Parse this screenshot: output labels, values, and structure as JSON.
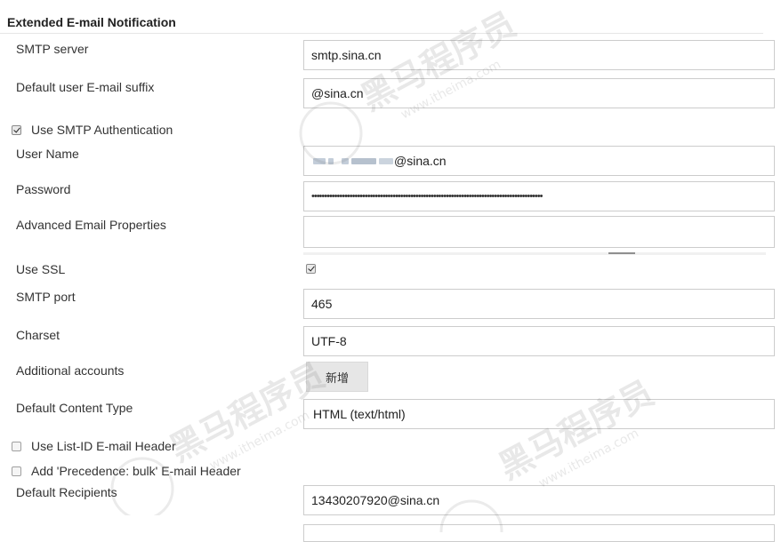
{
  "section": {
    "title": "Extended E-mail Notification"
  },
  "fields": {
    "smtp_server": {
      "label": "SMTP server",
      "value": "smtp.sina.cn"
    },
    "email_suffix": {
      "label": "Default user E-mail suffix",
      "value": "@sina.cn"
    },
    "use_smtp_auth": {
      "label": "Use SMTP Authentication",
      "checked": true
    },
    "user_name": {
      "label": "User Name",
      "value_suffix": "@sina.cn"
    },
    "password": {
      "label": "Password",
      "value": "•••••••••••••••••••••••••••••••••••••••••••••••••••••••••••••••••••••••••••••••••••••••••••"
    },
    "advanced_props": {
      "label": "Advanced Email Properties",
      "value": ""
    },
    "use_ssl": {
      "label": "Use SSL",
      "checked": true
    },
    "smtp_port": {
      "label": "SMTP port",
      "value": "465"
    },
    "charset": {
      "label": "Charset",
      "value": "UTF-8"
    },
    "additional_accounts": {
      "label": "Additional accounts",
      "button": "新增"
    },
    "content_type": {
      "label": "Default Content Type",
      "value": "HTML (text/html)"
    },
    "list_id": {
      "label": "Use List-ID E-mail Header",
      "checked": false
    },
    "precedence": {
      "label": "Add 'Precedence: bulk' E-mail Header",
      "checked": false
    },
    "recipients": {
      "label": "Default Recipients",
      "value": "13430207920@sina.cn"
    }
  },
  "watermark": {
    "brand": "黑马程序员",
    "url": "www.itheima.com"
  }
}
